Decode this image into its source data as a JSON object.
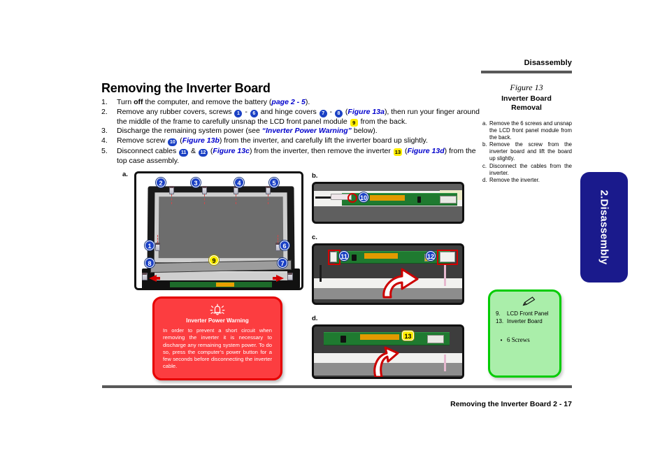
{
  "header": {
    "section_title": "Disassembly"
  },
  "main": {
    "title": "Removing the Inverter Board",
    "steps": [
      {
        "num": "1.",
        "parts": [
          {
            "t": "text",
            "v": "Turn "
          },
          {
            "t": "bold",
            "v": "off"
          },
          {
            "t": "text",
            "v": " the computer, and remove the battery ("
          },
          {
            "t": "ref",
            "v": "page 2 - 5"
          },
          {
            "t": "text",
            "v": ")."
          }
        ]
      },
      {
        "num": "2.",
        "parts": [
          {
            "t": "text",
            "v": "Remove any rubber covers, screws "
          },
          {
            "t": "chip",
            "v": "1"
          },
          {
            "t": "text",
            "v": " - "
          },
          {
            "t": "chip",
            "v": "6"
          },
          {
            "t": "text",
            "v": " and hinge covers "
          },
          {
            "t": "chip",
            "v": "7"
          },
          {
            "t": "text",
            "v": " - "
          },
          {
            "t": "chip",
            "v": "8"
          },
          {
            "t": "text",
            "v": "  ("
          },
          {
            "t": "ref",
            "v": "Figure 13a"
          },
          {
            "t": "text",
            "v": "), then run your finger around the middle of the frame to carefully unsnap the LCD front panel module "
          },
          {
            "t": "chipy",
            "v": "9"
          },
          {
            "t": "text",
            "v": " from the back."
          }
        ]
      },
      {
        "num": "3.",
        "parts": [
          {
            "t": "text",
            "v": "Discharge the remaining system power (see "
          },
          {
            "t": "ref",
            "v": "“Inverter Power Warning”"
          },
          {
            "t": "text",
            "v": " below)."
          }
        ]
      },
      {
        "num": "4.",
        "parts": [
          {
            "t": "text",
            "v": "Remove screw "
          },
          {
            "t": "chipw",
            "v": "10"
          },
          {
            "t": "text",
            "v": " ("
          },
          {
            "t": "ref",
            "v": "Figure 13b"
          },
          {
            "t": "text",
            "v": ") from the inverter, and carefully lift the inverter board up slightly."
          }
        ]
      },
      {
        "num": "5.",
        "parts": [
          {
            "t": "text",
            "v": "Disconnect cables "
          },
          {
            "t": "chipw",
            "v": "11"
          },
          {
            "t": "text",
            "v": " & "
          },
          {
            "t": "chipw",
            "v": "12"
          },
          {
            "t": "text",
            "v": " ("
          },
          {
            "t": "ref",
            "v": "Figure 13c"
          },
          {
            "t": "text",
            "v": ") from the inverter, then remove the inverter "
          },
          {
            "t": "chipy",
            "v": "13"
          },
          {
            "t": "text",
            "v": " ("
          },
          {
            "t": "ref",
            "v": "Figure 13d"
          },
          {
            "t": "text",
            "v": ") from the top case assembly."
          }
        ]
      }
    ]
  },
  "figure_caption": {
    "number": "Figure 13",
    "name_line1": "Inverter Board",
    "name_line2": "Removal",
    "notes": [
      {
        "letter": "a.",
        "text": "Remove the 6 screws and unsnap the LCD front panel module from the back."
      },
      {
        "letter": "b.",
        "text": "Remove the screw from the inverter board and lift the board up slightly."
      },
      {
        "letter": "c.",
        "text": "Disconnect the cables from the inverter."
      },
      {
        "letter": "d.",
        "text": "Remove the inverter."
      }
    ]
  },
  "side_tab": {
    "label": "2.Disassembly"
  },
  "figures": {
    "labels": {
      "a": "a.",
      "b": "b.",
      "c": "c.",
      "d": "d."
    },
    "panel_a_callouts": [
      "1",
      "2",
      "3",
      "4",
      "5",
      "6",
      "7",
      "8",
      "9"
    ],
    "panel_b_callouts": [
      "10"
    ],
    "panel_c_callouts": [
      "11",
      "12"
    ],
    "panel_d_callouts": [
      "13"
    ]
  },
  "warning_box": {
    "icon": "bell-alert-icon",
    "title": "Inverter Power Warning",
    "text": "In order to prevent a short circuit when removing the inverter it is necessary to discharge any remaining system power.  To do so, press the computer’s power button for a few seconds before disconnecting the inverter cable.",
    "bg_color": "#fc3d40",
    "border_color": "#e60000"
  },
  "note_box": {
    "icon": "pencil-icon",
    "items": [
      {
        "num": "9.",
        "label": "LCD Front Panel"
      },
      {
        "num": "13.",
        "label": "Inverter Board"
      }
    ],
    "bullet": "6 Screws",
    "bullet_marker": "•",
    "bg_color": "#aaeeaa",
    "border_color": "#00cc00"
  },
  "footer": {
    "text": "Removing the Inverter Board  2  -  17"
  },
  "colors": {
    "rule": "#595959",
    "callout_blue": "#1b41c4",
    "callout_yellow": "#ffee00",
    "ref_blue": "#0000cc",
    "tab_navy": "#1a1a8c"
  }
}
